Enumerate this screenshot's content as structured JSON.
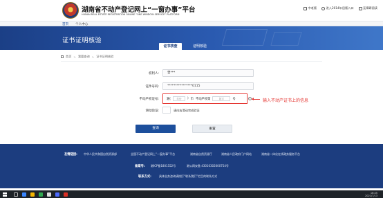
{
  "header": {
    "title_cn": "湖南省不动产登记网上“一窗办事”平台",
    "title_en": "HUNAN REAL ESTATE REGISTRATION ONLINE \"ONE WINDOW SERVICE\" PLATFORM",
    "links": [
      "中老版",
      "进入2014年旧版入口",
      "无障碍阅读"
    ]
  },
  "nav": {
    "items": [
      "首页",
      "个人中心"
    ]
  },
  "banner": {
    "title": "证书证明核验",
    "tabs": [
      "证书核查",
      "证明核验"
    ]
  },
  "breadcrumb": {
    "items": [
      "首页",
      "我要查询",
      "证书证明核验"
    ]
  },
  "form": {
    "owner_label": "权利人:",
    "owner_value": "曾***",
    "id_label": "证件号码:",
    "id_value": "****************0115",
    "cert_label": "不动产权证号:",
    "cert": {
      "prefix": "湘(",
      "year_placeholder": "年份",
      "middle": ")",
      "city_text": "市",
      "unit": "不动产权第",
      "number_placeholder": "数字",
      "suffix": "号"
    },
    "captcha_label": "滑动验证:",
    "captcha_text": "请向右滑动完成验证",
    "query_button": "查询",
    "reset_button": "重置"
  },
  "annotation": {
    "text": "输入不动产证书上的信息"
  },
  "footer": {
    "links_label": "友情链接:",
    "links": [
      "中华人民共和国自然资源部",
      "全国不动产登记网上“一窗办事”平台",
      "湖南省自然资源厅",
      "湖南省人民政府门户网站",
      "湖南省一体化在线政务服务平台"
    ],
    "icp_label": "备案号:",
    "icp": "湘ICP备1801552号",
    "police": "湘公网安备 43010302000754号",
    "contact_label": "联系方式:",
    "contact": "具体业务咨询请拨打“联系我们”栏目的联系方式"
  },
  "taskbar": {
    "time": "16:45",
    "date": "2021/7/13"
  }
}
